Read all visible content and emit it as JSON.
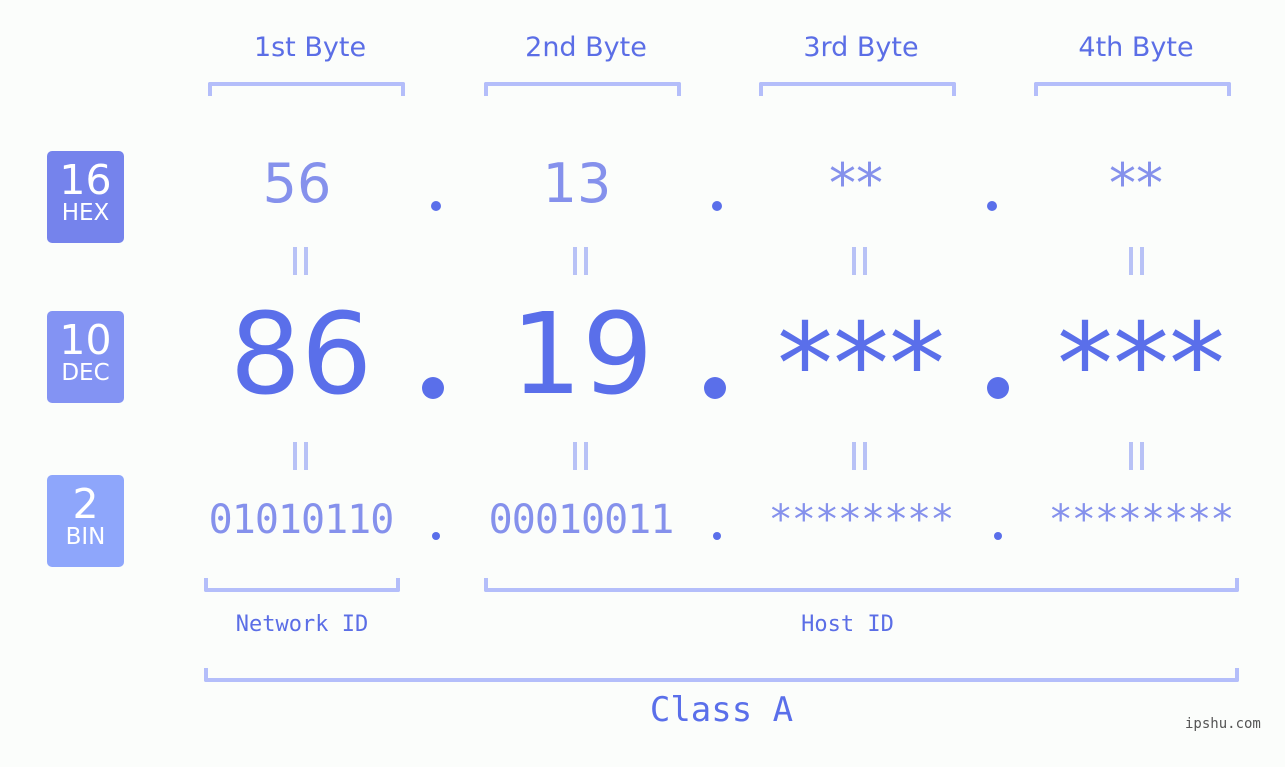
{
  "bytes": [
    {
      "header": "1st Byte",
      "hex": "56",
      "dec": "86",
      "bin": "01010110"
    },
    {
      "header": "2nd Byte",
      "hex": "13",
      "dec": "19",
      "bin": "00010011"
    },
    {
      "header": "3rd Byte",
      "hex": "**",
      "dec": "***",
      "bin": "********"
    },
    {
      "header": "4th Byte",
      "hex": "**",
      "dec": "***",
      "bin": "********"
    }
  ],
  "bases": {
    "hex": {
      "num": "16",
      "label": "HEX",
      "color": "#7583ec"
    },
    "dec": {
      "num": "10",
      "label": "DEC",
      "color": "#8393f3"
    },
    "bin": {
      "num": "2",
      "label": "BIN",
      "color": "#8ea6fb"
    }
  },
  "separators": {
    "dot": "."
  },
  "segments": {
    "network": "Network ID",
    "host": "Host ID",
    "class": "Class A"
  },
  "watermark": "ipshu.com",
  "colors": {
    "accent": "#5a6fea",
    "muted": "#8591ec",
    "bracket": "#b4befa",
    "background": "#fbfdfb"
  }
}
